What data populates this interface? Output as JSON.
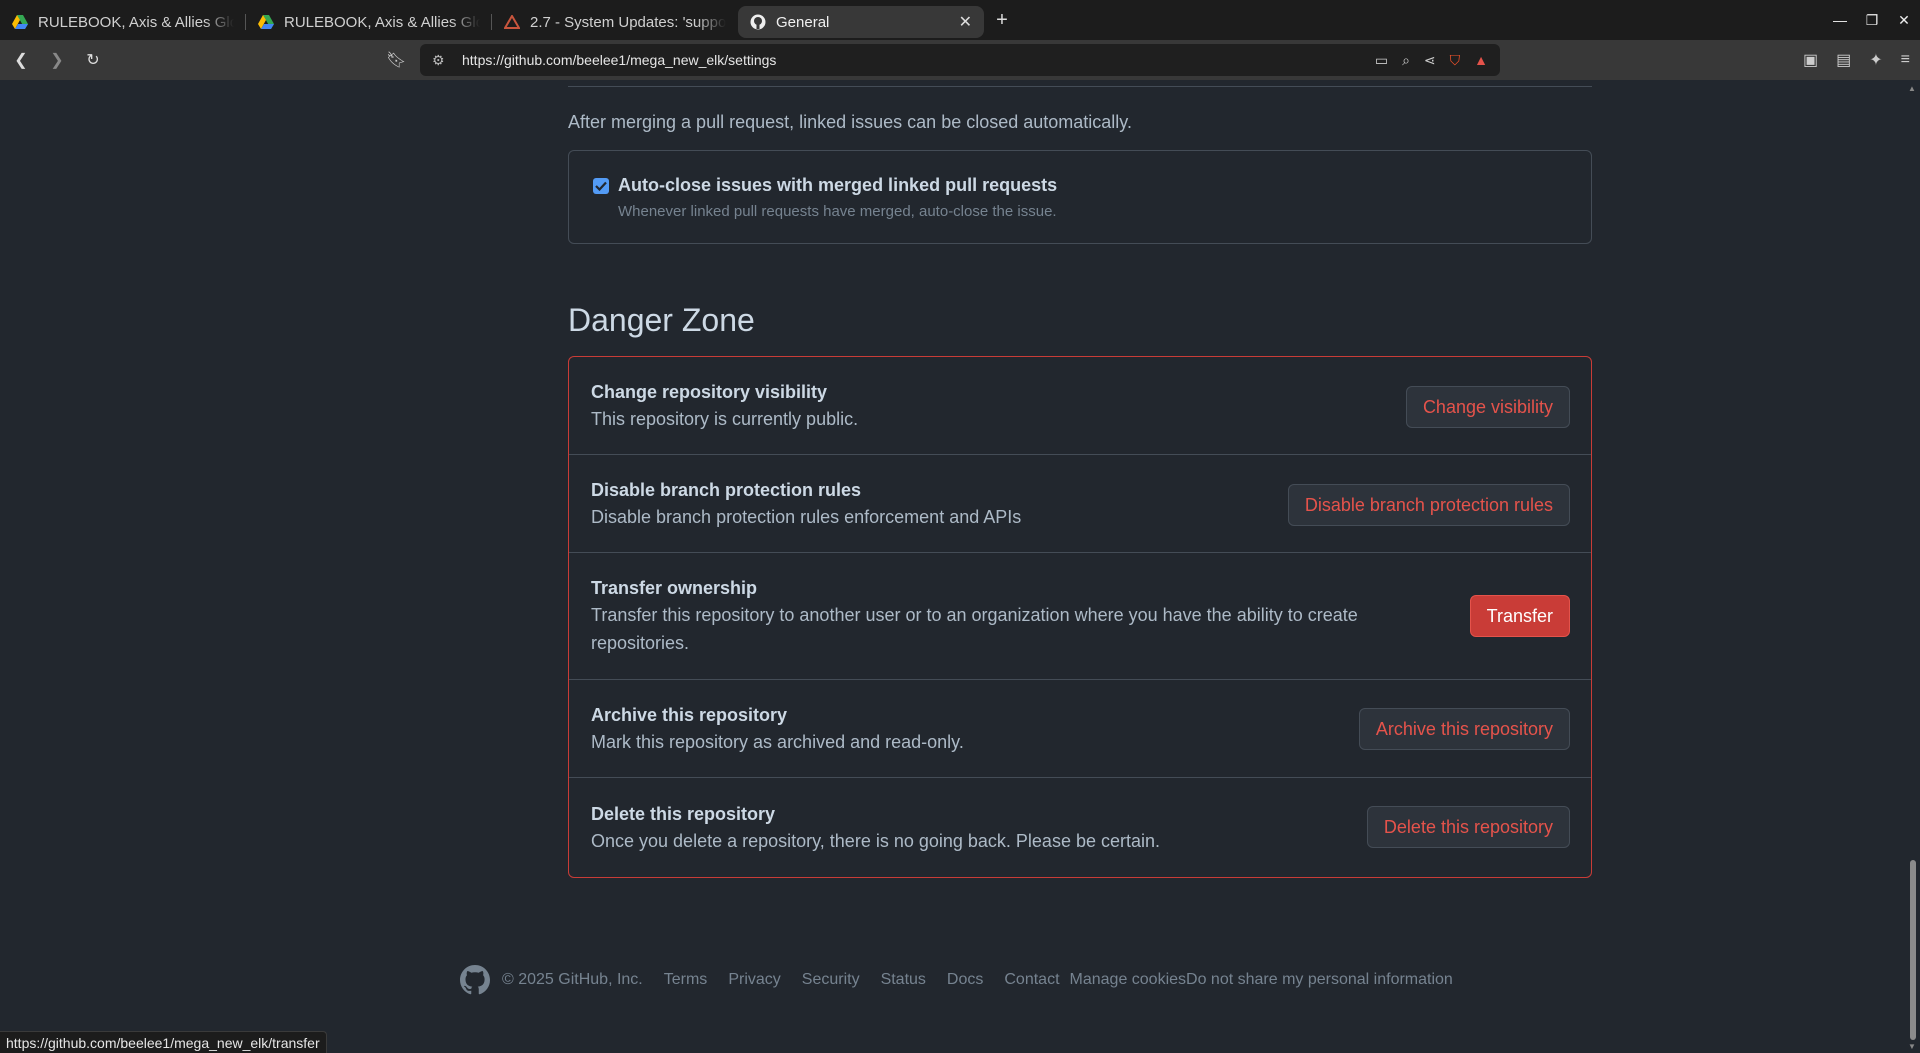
{
  "browser": {
    "tabs": [
      {
        "title": "RULEBOOK, Axis & Allies Glo",
        "icon": "google-drive-icon",
        "active": false
      },
      {
        "title": "RULEBOOK, Axis & Allies Glo",
        "icon": "google-drive-icon",
        "active": false
      },
      {
        "title": "2.7 - System Updates: 'suppo",
        "icon": "app-icon",
        "active": false
      },
      {
        "title": "General",
        "icon": "github-icon",
        "active": true
      }
    ],
    "url": "https://github.com/beelee1/mega_new_elk/settings",
    "status_url": "https://github.com/beelee1/mega_new_elk/transfer"
  },
  "autoclose": {
    "description": "After merging a pull request, linked issues can be closed automatically.",
    "label": "Auto-close issues with merged linked pull requests",
    "note": "Whenever linked pull requests have merged, auto-close the issue.",
    "checked": true
  },
  "danger_zone": {
    "title": "Danger Zone",
    "rows": [
      {
        "heading": "Change repository visibility",
        "desc": "This repository is currently public.",
        "button": "Change visibility"
      },
      {
        "heading": "Disable branch protection rules",
        "desc": "Disable branch protection rules enforcement and APIs",
        "button": "Disable branch protection rules"
      },
      {
        "heading": "Transfer ownership",
        "desc": "Transfer this repository to another user or to an organization where you have the ability to create repositories.",
        "button": "Transfer"
      },
      {
        "heading": "Archive this repository",
        "desc": "Mark this repository as archived and read-only.",
        "button": "Archive this repository"
      },
      {
        "heading": "Delete this repository",
        "desc": "Once you delete a repository, there is no going back. Please be certain.",
        "button": "Delete this repository"
      }
    ]
  },
  "footer": {
    "copyright": "© 2025 GitHub, Inc.",
    "links": [
      "Terms",
      "Privacy",
      "Security",
      "Status",
      "Docs",
      "Contact",
      "Manage cookies",
      "Do not share my personal information"
    ]
  },
  "colors": {
    "background": "#22272e",
    "danger": "#e5534b",
    "danger_border": "#c93c37",
    "accent": "#539bf5"
  }
}
